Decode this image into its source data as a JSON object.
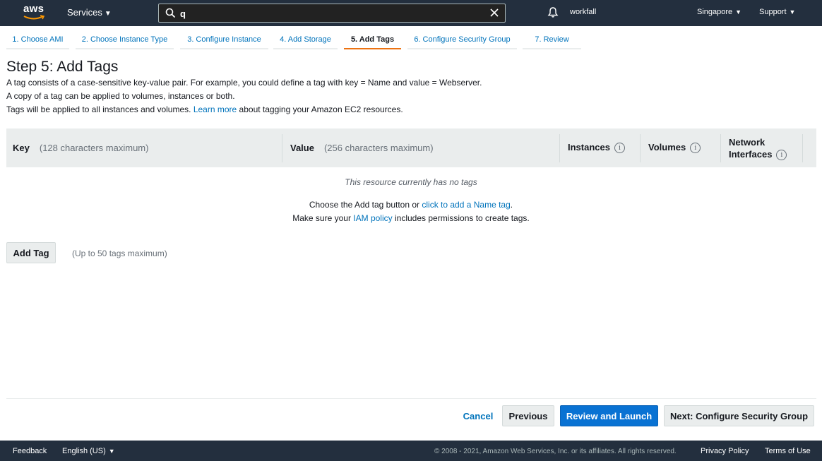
{
  "topnav": {
    "logo_text": "aws",
    "services_label": "Services",
    "search": {
      "value": "q",
      "placeholder": ""
    },
    "account_name": "workfall",
    "region_label": "Singapore",
    "support_label": "Support"
  },
  "steps": [
    {
      "label": "1. Choose AMI"
    },
    {
      "label": "2. Choose Instance Type"
    },
    {
      "label": "3. Configure Instance"
    },
    {
      "label": "4. Add Storage"
    },
    {
      "label": "5. Add Tags",
      "active": true
    },
    {
      "label": "6. Configure Security Group"
    },
    {
      "label": "7. Review"
    }
  ],
  "header": {
    "title": "Step 5: Add Tags",
    "line1": "A tag consists of a case-sensitive key-value pair. For example, you could define a tag with key = Name and value = Webserver.",
    "line2": "A copy of a tag can be applied to volumes, instances or both.",
    "line3_prefix": "Tags will be applied to all instances and volumes.",
    "line3_link": "Learn more",
    "line3_suffix": "about tagging your Amazon EC2 resources."
  },
  "table": {
    "key_header": "Key",
    "key_hint": "(128 characters maximum)",
    "value_header": "Value",
    "value_hint": "(256 characters maximum)",
    "instances_header": "Instances",
    "volumes_header": "Volumes",
    "network_header_line1": "Network",
    "network_header_line2": "Interfaces",
    "info_glyph": "i",
    "empty_message": "This resource currently has no tags",
    "choose_prefix": "Choose the Add tag button or",
    "choose_link": "click to add a Name tag",
    "choose_suffix": ".",
    "policy_prefix": "Make sure your",
    "policy_link": "IAM policy",
    "policy_suffix": "includes permissions to create tags."
  },
  "add_tag": {
    "button_label": "Add Tag",
    "hint": "(Up to 50 tags maximum)"
  },
  "actions": {
    "cancel": "Cancel",
    "previous": "Previous",
    "review": "Review and Launch",
    "next": "Next: Configure Security Group"
  },
  "footer": {
    "feedback": "Feedback",
    "language": "English (US)",
    "copyright": "© 2008 - 2021, Amazon Web Services, Inc. or its affiliates. All rights reserved.",
    "privacy": "Privacy Policy",
    "terms": "Terms of Use"
  },
  "colors": {
    "nav_bg": "#232f3e",
    "link": "#0073bb",
    "active_tab": "#ec7211",
    "primary_button": "#0972d3"
  }
}
